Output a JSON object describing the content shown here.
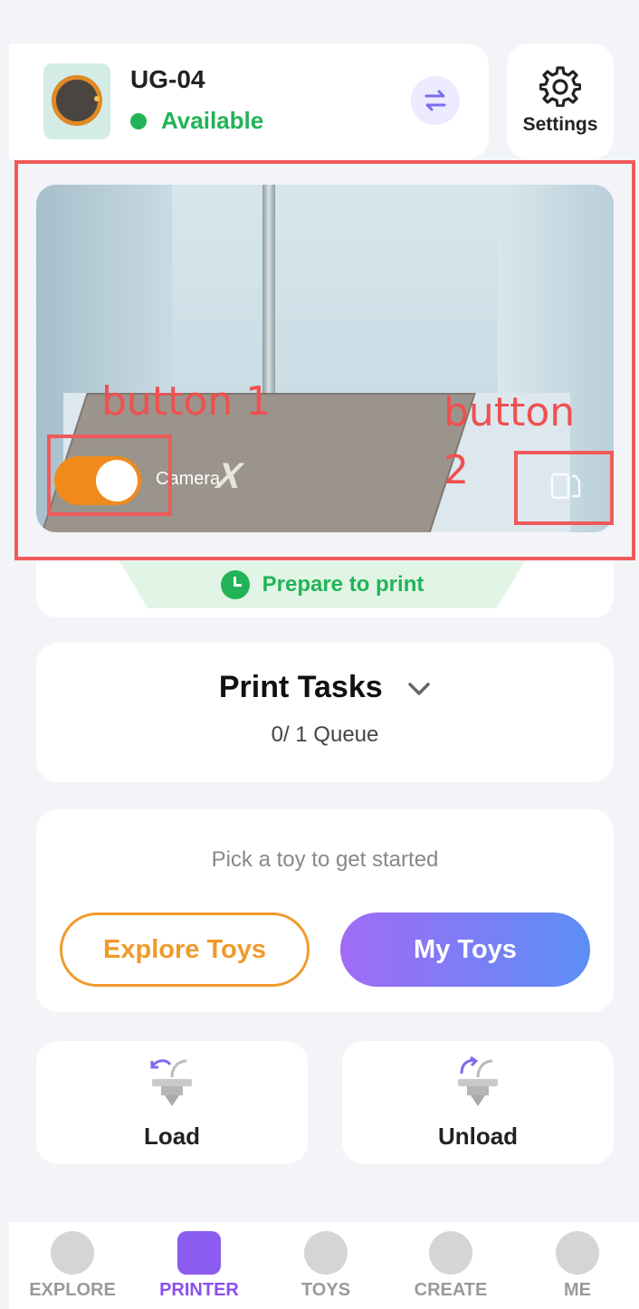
{
  "device": {
    "name": "UG-04",
    "status": "Available"
  },
  "settings": {
    "label": "Settings"
  },
  "camera": {
    "toggle_label": "Camera",
    "toggle_on": true,
    "plate_logo": "X"
  },
  "annotations": {
    "button1": "button 1",
    "button2_line1": "button",
    "button2_line2": "2"
  },
  "print_status": {
    "text": "Prepare to print"
  },
  "print_tasks": {
    "title": "Print Tasks",
    "queue": "0/ 1 Queue"
  },
  "pick": {
    "prompt": "Pick a toy to get started",
    "explore_label": "Explore Toys",
    "mytoys_label": "My Toys"
  },
  "filament": {
    "load_label": "Load",
    "unload_label": "Unload"
  },
  "tab_bar": {
    "tabs": [
      {
        "label": "EXPLORE",
        "icon": "planet-icon",
        "active": false
      },
      {
        "label": "PRINTER",
        "icon": "printer-icon",
        "active": true
      },
      {
        "label": "TOYS",
        "icon": "bear-icon",
        "active": false
      },
      {
        "label": "CREATE",
        "icon": "bulb-icon",
        "active": false
      },
      {
        "label": "ME",
        "icon": "face-icon",
        "active": false
      }
    ]
  },
  "colors": {
    "accent_orange": "#f08a1a",
    "status_green": "#22b357",
    "accent_purple": "#8a4ff0",
    "annotation_red": "#f05a5a"
  }
}
